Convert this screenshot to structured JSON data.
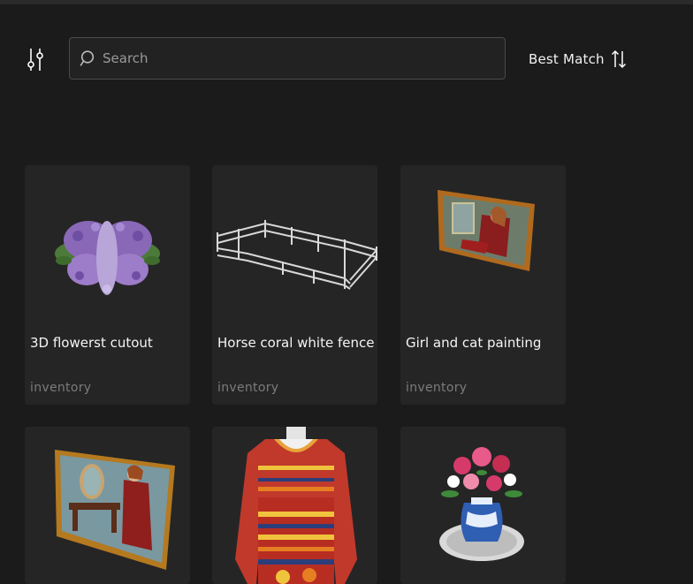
{
  "search": {
    "placeholder": "Search",
    "value": ""
  },
  "sort": {
    "label": "Best Match"
  },
  "icons": {
    "filter": "sliders-icon",
    "search": "search-icon",
    "sort": "sort-arrows-icon"
  },
  "items": [
    {
      "title": "3D flowerst cutout",
      "category": "inventory",
      "thumb": "purple-flower-cutout"
    },
    {
      "title": "Horse coral white fence",
      "category": "inventory",
      "thumb": "white-fence-corral"
    },
    {
      "title": "Girl and cat painting",
      "category": "inventory",
      "thumb": "framed-painting-girl-cat"
    },
    {
      "title": "",
      "category": "",
      "thumb": "framed-painting-woman-mirror"
    },
    {
      "title": "",
      "category": "",
      "thumb": "patterned-red-dress"
    },
    {
      "title": "",
      "category": "",
      "thumb": "flower-vase"
    }
  ],
  "colors": {
    "background": "#1b1b1b",
    "card": "#252525",
    "muted_text": "#7b7b7b"
  }
}
